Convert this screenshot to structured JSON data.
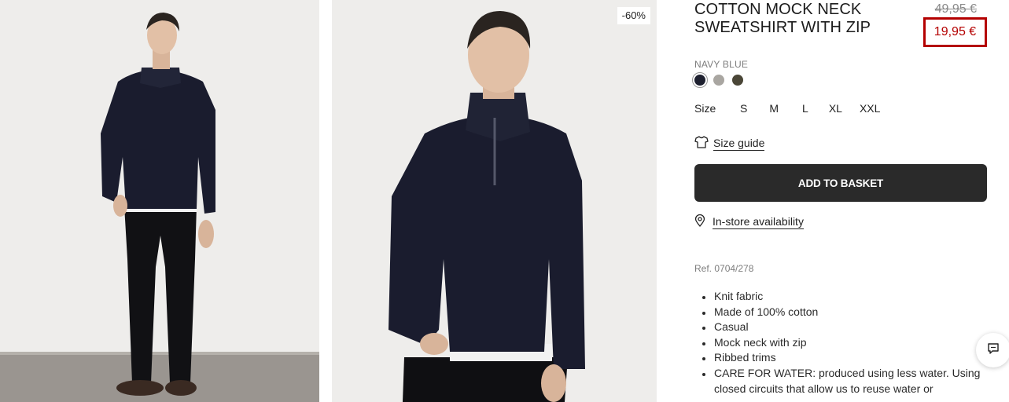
{
  "product": {
    "title": "COTTON MOCK NECK SWEATSHIRT WITH ZIP",
    "discount_badge": "-60%",
    "price_old": "49,95 €",
    "price_new": "19,95 €",
    "color_name": "NAVY BLUE",
    "swatches": [
      {
        "name": "navy",
        "color": "#1e2030",
        "selected": true
      },
      {
        "name": "grey",
        "color": "#a9a6a1",
        "selected": false
      },
      {
        "name": "olive",
        "color": "#4a4637",
        "selected": false
      }
    ],
    "size_label": "Size",
    "sizes": [
      "S",
      "M",
      "L",
      "XL",
      "XXL"
    ],
    "size_guide_label": "Size guide",
    "add_to_basket_label": "ADD TO BASKET",
    "store_availability_label": "In-store availability",
    "reference": "Ref. 0704/278",
    "features": [
      "Knit fabric",
      "Made of 100% cotton",
      "Casual",
      "Mock neck with zip",
      "Ribbed trims",
      "CARE FOR WATER: produced using less water. Using closed circuits that allow us to reuse water or"
    ]
  },
  "icons": {
    "size_guide": "tshirt-icon",
    "store": "location-pin-icon",
    "chat": "chat-bubble-icon"
  }
}
